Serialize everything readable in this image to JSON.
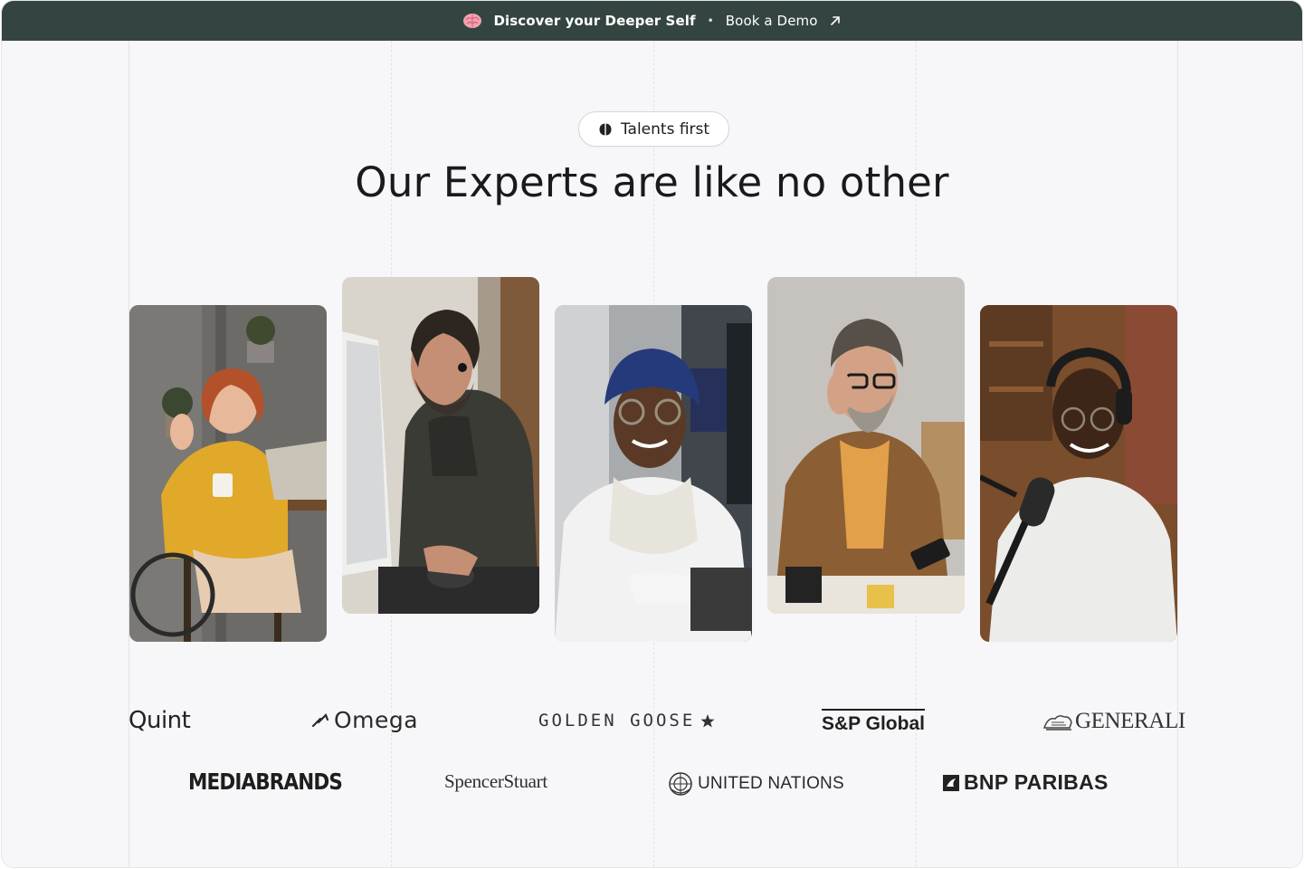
{
  "topbar": {
    "message": "Discover your Deeper Self",
    "separator": "•",
    "demo_link": "Book a Demo",
    "brain_icon": "brain-icon",
    "arrow_icon": "arrow-up-right-icon",
    "background": "#344541"
  },
  "hero": {
    "badge": "Talents first",
    "badge_icon": "leaf-icon",
    "title": "Our Experts are like no other"
  },
  "experts": [
    {
      "name": "expert-photo-woman-wheelchair-laptop"
    },
    {
      "name": "expert-photo-man-earbud-computer"
    },
    {
      "name": "expert-photo-woman-headscarf-glasses"
    },
    {
      "name": "expert-photo-man-glasses-phone"
    },
    {
      "name": "expert-photo-man-headphones-microphone"
    }
  ],
  "logos": {
    "row1": [
      "Quint",
      "Omega",
      "GOLDEN GOOSE",
      "S&P Global",
      "GENERALI"
    ],
    "row2": [
      "MEDIABRANDS",
      "SpencerStuart",
      "UNITED NATIONS",
      "BNP PARIBAS"
    ]
  },
  "colors": {
    "page_bg": "#f7f7f9",
    "text": "#1a1a1d",
    "accent": "#344541"
  }
}
